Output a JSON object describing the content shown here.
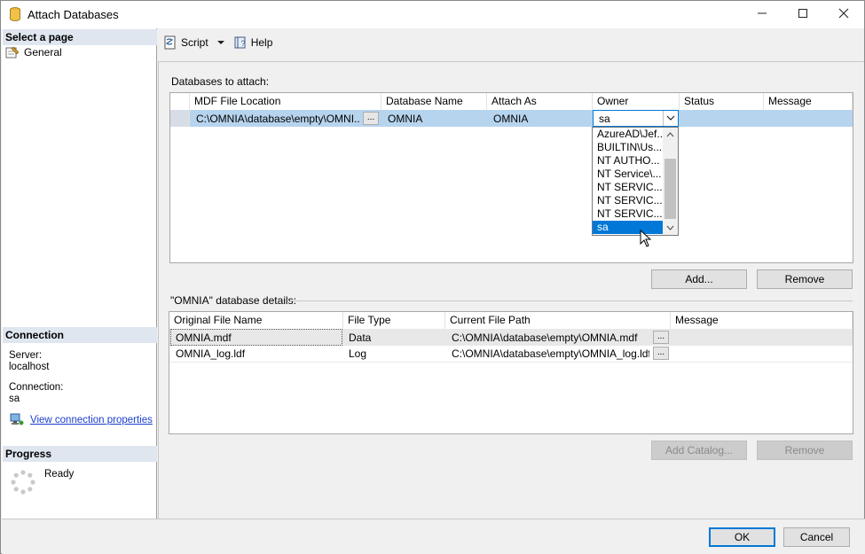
{
  "window": {
    "title": "Attach Databases",
    "minimize_icon": "minimize-icon",
    "maximize_icon": "maximize-icon",
    "close_icon": "close-icon"
  },
  "left": {
    "select_page_heading": "Select a page",
    "pages": [
      {
        "label": "General",
        "icon": "wrench-page-icon"
      }
    ],
    "connection_heading": "Connection",
    "server_label": "Server:",
    "server_value": "localhost",
    "connection_label": "Connection:",
    "connection_value": "sa",
    "view_props_link": "View connection properties",
    "progress_heading": "Progress",
    "progress_status": "Ready"
  },
  "toolbar": {
    "script_label": "Script",
    "help_label": "Help"
  },
  "attach": {
    "section_label": "Databases to attach:",
    "columns": [
      "MDF File Location",
      "Database Name",
      "Attach As",
      "Owner",
      "Status",
      "Message"
    ],
    "rows": [
      {
        "mdf": "C:\\OMNIA\\database\\empty\\OMNI...",
        "dbname": "OMNIA",
        "attach_as": "OMNIA",
        "owner": "sa",
        "status": "",
        "message": ""
      }
    ],
    "ellipsis": "...",
    "owner_options": [
      "AzureAD\\Jef...",
      "BUILTIN\\Us...",
      "NT AUTHO...",
      "NT Service\\...",
      "NT SERVIC...",
      "NT SERVIC...",
      "NT SERVIC...",
      "sa"
    ],
    "owner_selected": "sa",
    "add_button": "Add...",
    "remove_button": "Remove"
  },
  "details": {
    "section_label": "\"OMNIA\" database details:",
    "columns": [
      "Original File Name",
      "File Type",
      "Current File Path",
      "Message"
    ],
    "rows": [
      {
        "name": "OMNIA.mdf",
        "type": "Data",
        "path": "C:\\OMNIA\\database\\empty\\OMNIA.mdf",
        "message": ""
      },
      {
        "name": "OMNIA_log.ldf",
        "type": "Log",
        "path": "C:\\OMNIA\\database\\empty\\OMNIA_log.ldf",
        "message": ""
      }
    ],
    "add_catalog_button": "Add Catalog...",
    "remove_button": "Remove"
  },
  "footer": {
    "ok_button": "OK",
    "cancel_button": "Cancel"
  },
  "colors": {
    "selection": "#b7d4ee",
    "dropdown_selected": "#0078d7",
    "section_header": "#dfe6ef",
    "link": "#1a3ecc"
  }
}
